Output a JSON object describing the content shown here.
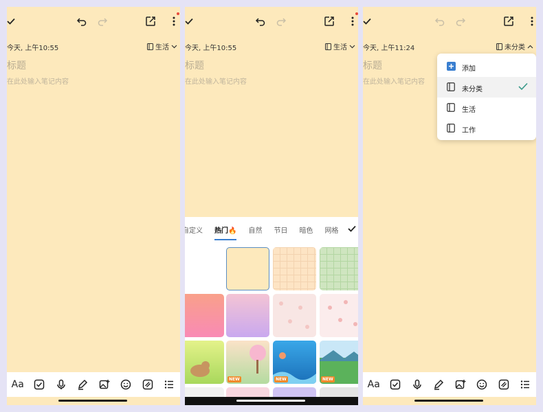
{
  "colors": {
    "note_bg": "#fde9bc",
    "accent_blue": "#3a7fd0",
    "check_teal": "#3a9a8a",
    "new_badge": "#f08a2a"
  },
  "panels": [
    {
      "date": "今天, 上午10:55",
      "category": "生活",
      "title_placeholder": "标题",
      "body_placeholder": "在此处输入笔记内容"
    },
    {
      "date": "今天, 上午10:55",
      "category": "生活",
      "title_placeholder": "标题",
      "body_placeholder": "在此处输入笔记内容",
      "tabs": [
        "自定义",
        "热门🔥",
        "自然",
        "节日",
        "暗色",
        "网格"
      ],
      "active_tab": "热门🔥",
      "new_badge": "NEW"
    },
    {
      "date": "今天, 上午11:24",
      "category": "未分类",
      "title_placeholder": "标题",
      "body_placeholder": "在此处输入笔记内容",
      "dropdown": [
        "添加",
        "未分类",
        "生活",
        "工作"
      ],
      "dropdown_selected": "未分类"
    }
  ],
  "toolbar": {
    "aa_label": "Aa"
  },
  "icons": [
    "check-icon",
    "undo-icon",
    "redo-icon",
    "share-icon",
    "more-icon",
    "notebook-icon",
    "chevron-down-icon",
    "chevron-up-icon",
    "checkbox-icon",
    "mic-icon",
    "pen-icon",
    "image-icon",
    "emoji-icon",
    "theme-icon",
    "list-icon",
    "plus-icon"
  ]
}
